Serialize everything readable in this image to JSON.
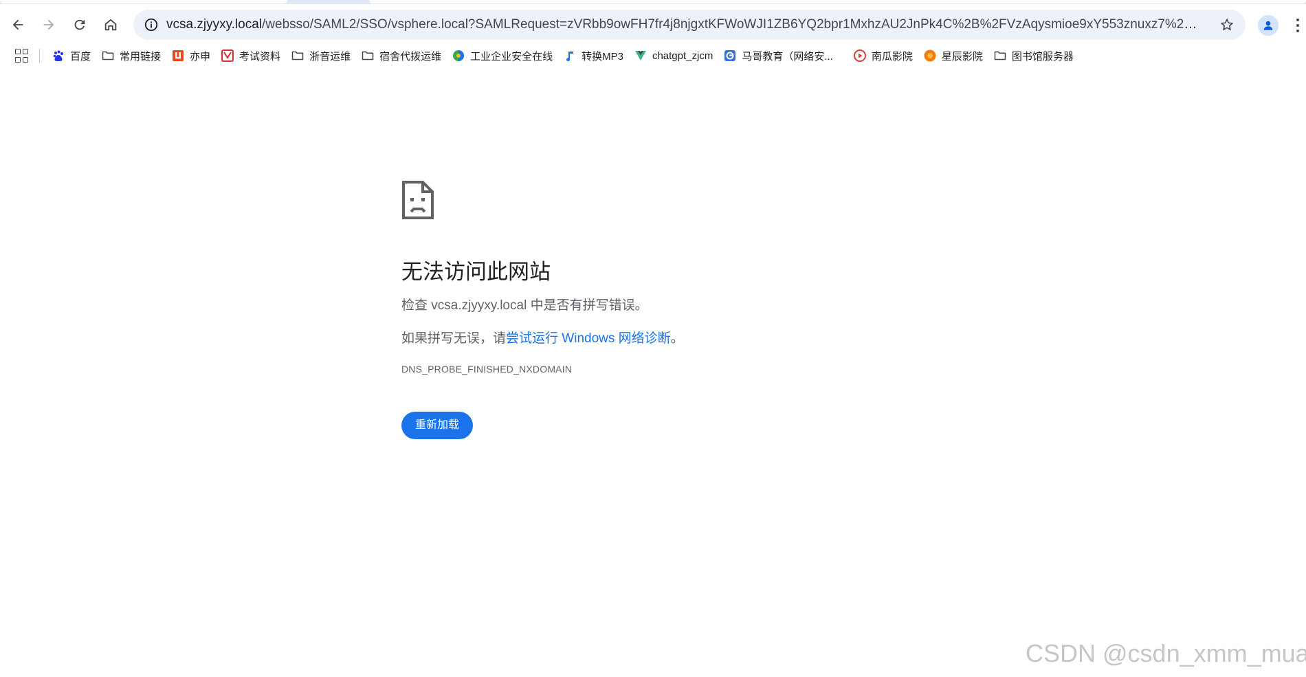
{
  "browser": {
    "url_host": "vcsa.zjyyxy.local",
    "url_path": "/websso/SAML2/SSO/vsphere.local?SAMLRequest=zVRbb9owFH7fr4j8njgxtKFWoWJI1ZB6YQ2bpr1MxhzAU2JnPk4C%2B%2FVzAqysmioe9xY553znuxz7%2BmZb5EE..."
  },
  "bookmarks": [
    {
      "label": "百度",
      "icon": "baidu-icon",
      "color": "#2932e1"
    },
    {
      "label": "常用链接",
      "icon": "folder-icon"
    },
    {
      "label": "亦申",
      "icon": "yishen-icon",
      "color": "#e8491d"
    },
    {
      "label": "考试资料",
      "icon": "exam-icon",
      "color": "#d32f2f"
    },
    {
      "label": "浙音运维",
      "icon": "folder-icon"
    },
    {
      "label": "宿舍代拨运维",
      "icon": "folder-icon"
    },
    {
      "label": "工业企业安全在线",
      "icon": "globe-icon",
      "color": "#34a853"
    },
    {
      "label": "转换MP3",
      "icon": "music-note-icon",
      "color": "#1a73e8"
    },
    {
      "label": "chatgpt_zjcm",
      "icon": "vue-icon",
      "color": "#41b883"
    },
    {
      "label": "马哥教育（网络安...",
      "icon": "mage-icon",
      "color": "#3b6fd8"
    },
    {
      "label": "南瓜影院",
      "icon": "pumpkin-play-icon",
      "color": "#e53935"
    },
    {
      "label": "星辰影院",
      "icon": "star-movie-icon",
      "color": "#f57c00"
    },
    {
      "label": "图书馆服务器",
      "icon": "folder-icon"
    }
  ],
  "error": {
    "title": "无法访问此网站",
    "line1": "检查 vcsa.zjyyxy.local 中是否有拼写错误。",
    "line2_prefix": "如果拼写无误，请",
    "line2_link": "尝试运行 Windows 网络诊断",
    "line2_suffix": "。",
    "code": "DNS_PROBE_FINISHED_NXDOMAIN",
    "reload_label": "重新加载"
  },
  "watermark": "CSDN @csdn_xmm_mua"
}
